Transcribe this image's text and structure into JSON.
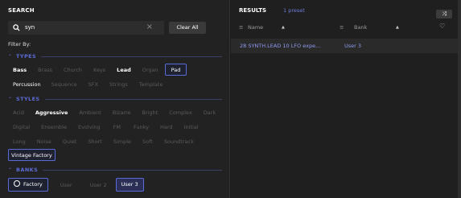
{
  "search": {
    "header": "SEARCH",
    "query": "syn",
    "clear_x": "×",
    "clear_all_label": "Clear All",
    "filter_by": "Filter By:"
  },
  "types": {
    "label": "TYPES",
    "row1": [
      "Bass",
      "Brass",
      "Church",
      "Keys",
      "Lead",
      "Organ",
      "Pad"
    ],
    "row2": [
      "Percussion",
      "Sequence",
      "SFX",
      "Strings",
      "Template"
    ]
  },
  "styles": {
    "label": "STYLES",
    "row1": [
      "Acid",
      "Aggressive",
      "Ambient",
      "Bizarre",
      "Bright",
      "Complex",
      "Dark"
    ],
    "row2": [
      "Digital",
      "Ensemble",
      "Evolving",
      "FM",
      "Funky",
      "Hard",
      "Initial"
    ],
    "row3": [
      "Long",
      "Noise",
      "Quiet",
      "Short",
      "Simple",
      "Soft",
      "Soundtrack"
    ],
    "row4": [
      "Vintage Factory"
    ]
  },
  "banks": {
    "label": "BANKS",
    "items": [
      "Factory",
      "User",
      "User 2",
      "User 3"
    ]
  },
  "results": {
    "title": "RESULTS",
    "count": "1 preset",
    "shuffle_icon": "⤨",
    "col_name": "Name",
    "col_bank": "Bank",
    "sort_icon": "▲",
    "menu_icon": "≡",
    "heart_icon": "♡",
    "rows": [
      {
        "name": "28 SYNTH.LEAD 10 LFO expe...",
        "bank": "User 3"
      }
    ]
  },
  "colors": {
    "accent": "#5b6bd6",
    "link": "#8e9af0",
    "background": "#222222"
  }
}
